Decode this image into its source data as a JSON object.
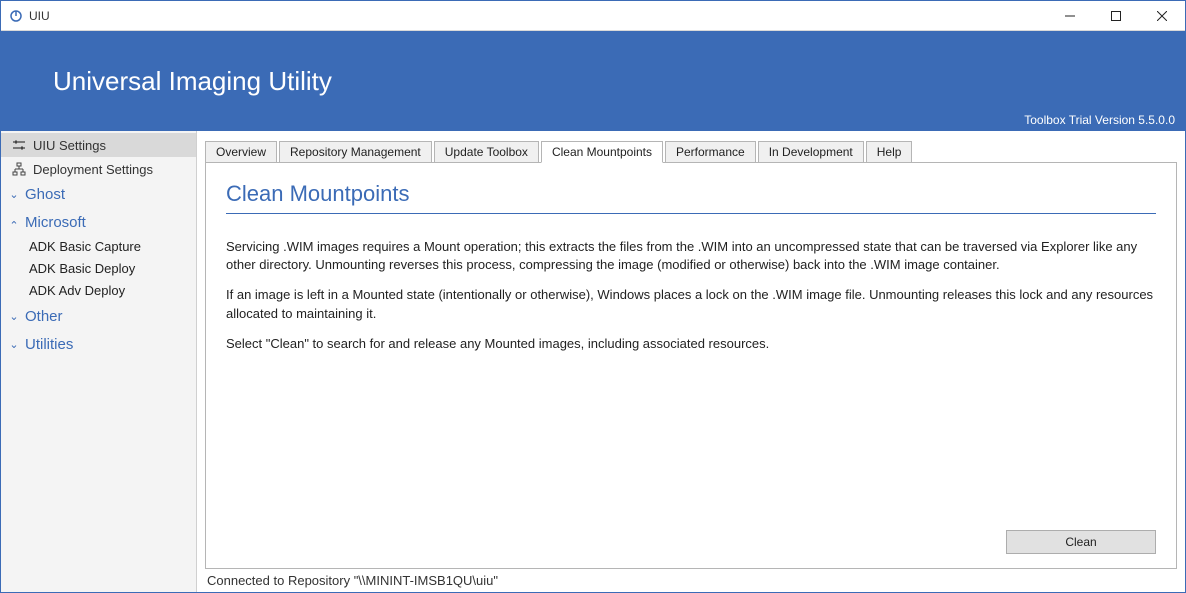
{
  "window": {
    "title": "UIU"
  },
  "banner": {
    "heading": "Universal Imaging Utility",
    "version_text": "Toolbox Trial Version 5.5.0.0"
  },
  "sidebar": {
    "top_items": [
      {
        "label": "UIU Settings",
        "selected": true
      },
      {
        "label": "Deployment Settings",
        "selected": false
      }
    ],
    "groups": [
      {
        "label": "Ghost",
        "expanded": false,
        "items": []
      },
      {
        "label": "Microsoft",
        "expanded": true,
        "items": [
          {
            "label": "ADK Basic Capture"
          },
          {
            "label": "ADK Basic Deploy"
          },
          {
            "label": "ADK Adv Deploy"
          }
        ]
      },
      {
        "label": "Other",
        "expanded": false,
        "items": []
      },
      {
        "label": "Utilities",
        "expanded": false,
        "items": []
      }
    ]
  },
  "tabs": [
    {
      "label": "Overview",
      "active": false
    },
    {
      "label": "Repository Management",
      "active": false
    },
    {
      "label": "Update Toolbox",
      "active": false
    },
    {
      "label": "Clean Mountpoints",
      "active": true
    },
    {
      "label": "Performance",
      "active": false
    },
    {
      "label": "In Development",
      "active": false
    },
    {
      "label": "Help",
      "active": false
    }
  ],
  "panel": {
    "heading": "Clean Mountpoints",
    "paragraphs": [
      "Servicing .WIM images requires a Mount operation; this extracts the files from the .WIM into an uncompressed state that can be traversed via Explorer like any other directory. Unmounting reverses this process, compressing the image (modified or otherwise) back into the .WIM image container.",
      "If an image is left in a Mounted state (intentionally or otherwise), Windows places a lock on the .WIM image file. Unmounting releases this lock and any resources allocated to maintaining it.",
      "Select \"Clean\" to search for and release any Mounted images, including associated resources."
    ],
    "button_label": "Clean"
  },
  "status": {
    "text": "Connected to Repository \"\\\\MININT-IMSB1QU\\uiu\""
  }
}
